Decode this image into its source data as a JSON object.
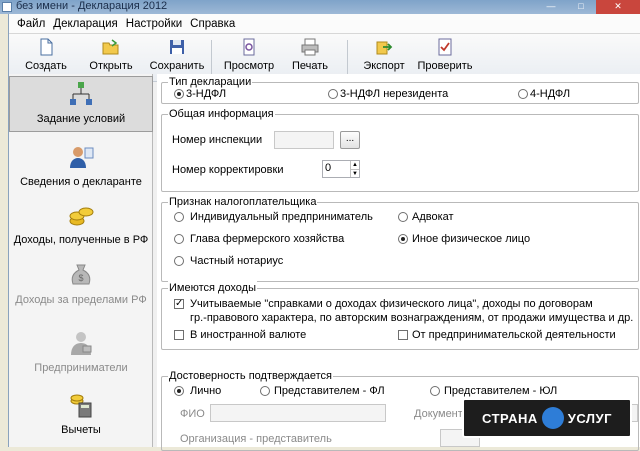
{
  "window": {
    "title": "без имени - Декларация 2012"
  },
  "menu": [
    "Файл",
    "Декларация",
    "Настройки",
    "Справка"
  ],
  "toolbar": {
    "buttons": [
      "Создать",
      "Открыть",
      "Сохранить",
      "Просмотр",
      "Печать",
      "Экспорт",
      "Проверить"
    ]
  },
  "sidebar": {
    "items": [
      {
        "label": "Задание условий",
        "icon": "network-tree-icon",
        "selected": true
      },
      {
        "label": "Сведения о декларанте",
        "icon": "person-card-icon"
      },
      {
        "label": "Доходы, полученные в РФ",
        "icon": "coins-icon"
      },
      {
        "label": "Доходы за пределами РФ",
        "icon": "money-bag-icon",
        "disabled": true
      },
      {
        "label": "Предприниматели",
        "icon": "businessman-icon",
        "disabled": true
      },
      {
        "label": "Вычеты",
        "icon": "calculator-icon"
      }
    ]
  },
  "decl_type": {
    "title": "Тип декларации",
    "options": [
      "3-НДФЛ",
      "3-НДФЛ нерезидента",
      "4-НДФЛ"
    ],
    "selected": "3-НДФЛ"
  },
  "general": {
    "title": "Общая информация",
    "inspection_label": "Номер инспекции",
    "inspection_value": "",
    "browse_label": "...",
    "correction_label": "Номер корректировки",
    "correction_value": "0"
  },
  "taxpayer": {
    "title": "Признак налогоплательщика",
    "options": [
      "Индивидуальный предприниматель",
      "Адвокат",
      "Глава фермерского хозяйства",
      "Иное физическое лицо",
      "Частный нотариус"
    ],
    "selected": "Иное физическое лицо"
  },
  "income": {
    "title": "Имеются доходы",
    "certified_line1": "Учитываемые \"справками о доходах физического лица\", доходы по договорам",
    "certified_line2": "гр.-правового характера, по авторским вознаграждениям, от продажи имущества и др.",
    "certified_checked": true,
    "foreign_currency": "В иностранной валюте",
    "business": "От предпринимательской деятельности"
  },
  "confirm": {
    "title": "Достоверность подтверждается",
    "options": [
      "Лично",
      "Представителем - ФЛ",
      "Представителем - ЮЛ"
    ],
    "selected": "Лично",
    "fio_label": "ФИО",
    "document_label": "Документ",
    "org_label": "Организация - представитель"
  },
  "watermark": {
    "left": "СТРАНА",
    "right": "УСЛУГ"
  }
}
